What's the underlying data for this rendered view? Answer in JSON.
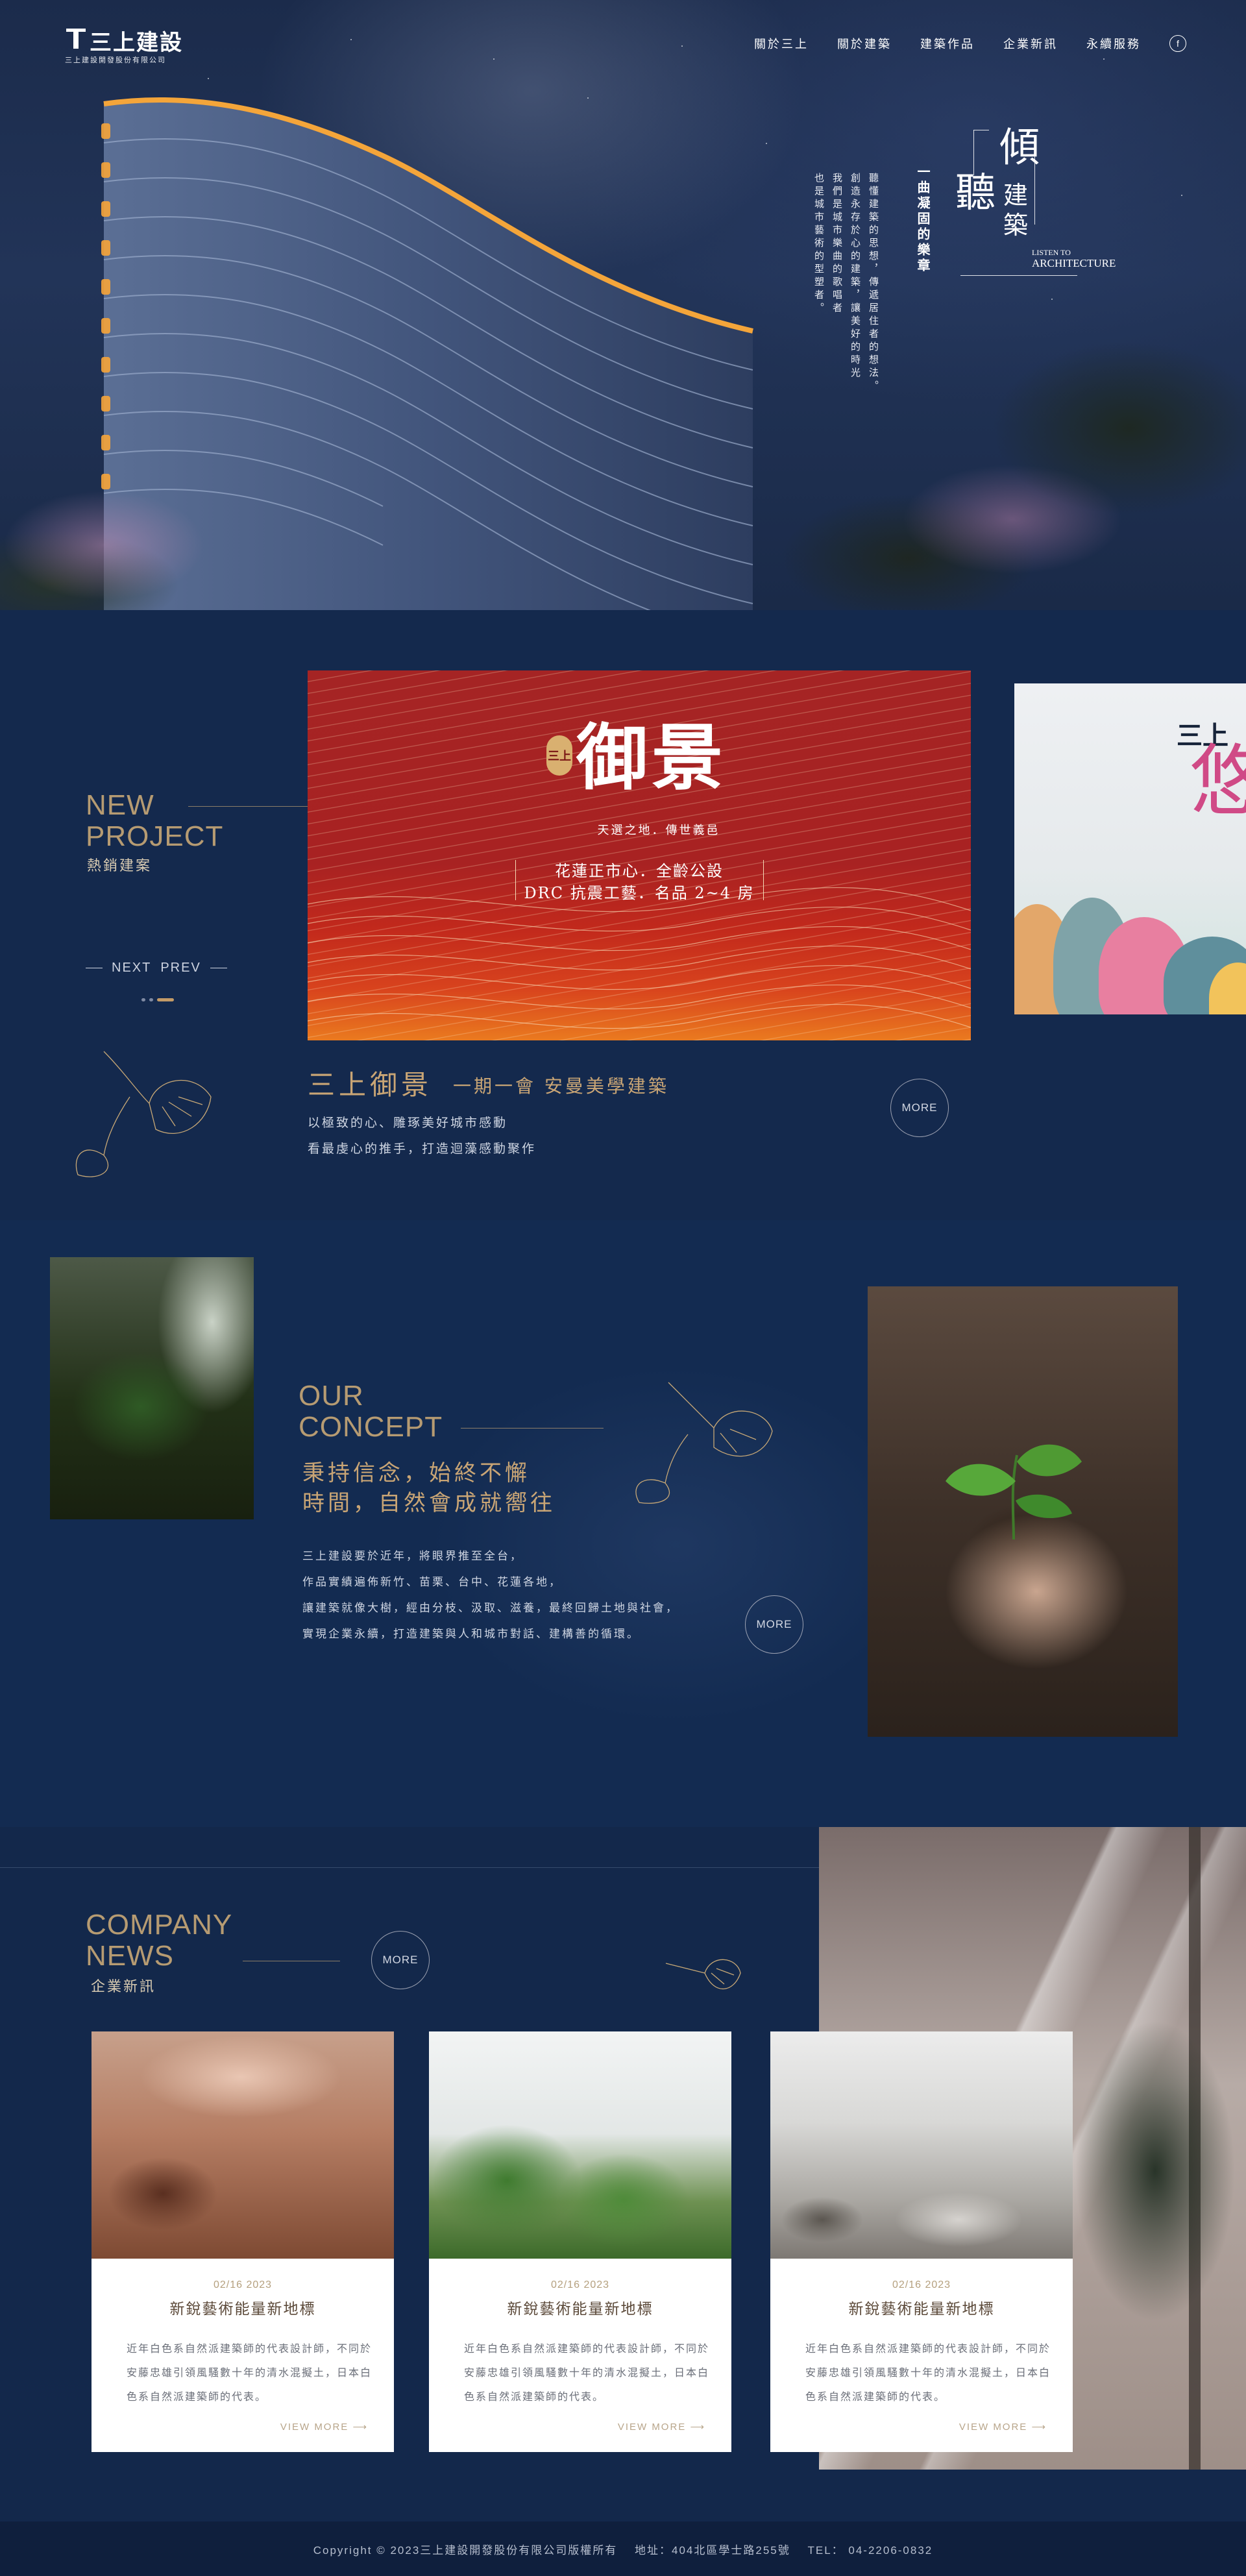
{
  "brand": {
    "name": "三上建設",
    "subtitle": "三上建設開發股份有限公司"
  },
  "nav": {
    "items": [
      "關於三上",
      "關於建築",
      "建築作品",
      "企業新訊",
      "永續服務"
    ],
    "social_icon": "f"
  },
  "hero": {
    "big_1": "傾",
    "big_2": "聽",
    "small_1": "建",
    "small_2": "築",
    "vertical_title": "一曲凝固的樂章",
    "vertical_lines": [
      "聽懂建築的思想，傳遞居住者的想法。",
      "創造永存於心的建築，讓美好的時光",
      "我們是城市樂曲的歌唱者",
      "也是城市藝術的型塑者。"
    ],
    "en_1": "LISTEN TO",
    "en_2": "ARCHITECTURE"
  },
  "project": {
    "en_line1": "NEW",
    "en_line2": "PROJECT",
    "zh": "熱銷建案",
    "nav_next": "NEXT",
    "nav_prev": "PREV",
    "featured": {
      "seal": "三上",
      "brand": "御景",
      "slogan": "天選之地．傳世義邑",
      "tagline_1": "花蓮正市心．全齡公設",
      "tagline_2": "DRC 抗震工藝．名品 2~4 房"
    },
    "next_slide": {
      "mini_brand": "三上",
      "char": "悠"
    },
    "title": "三上御景",
    "title_sub": "一期一會 安曼美學建築",
    "desc_1": "以極致的心、雕琢美好城市感動",
    "desc_2": "看最虔心的推手，打造迴藻感動聚作",
    "more": "MORE"
  },
  "concept": {
    "en_line1": "OUR",
    "en_line2": "CONCEPT",
    "quote_1": "秉持信念，始終不懈",
    "quote_2": "時間，自然會成就嚮往",
    "body": [
      "三上建設要於近年，將眼界推至全台，",
      "作品實績遍佈新竹、苗栗、台中、花蓮各地，",
      "讓建築就像大樹，經由分枝、汲取、滋養，最終回歸土地與社會，",
      "實現企業永續，打造建築與人和城市對話、建構善的循環。"
    ],
    "more": "MORE"
  },
  "news": {
    "en_line1": "COMPANY",
    "en_line2": "NEWS",
    "zh": "企業新訊",
    "more": "MORE",
    "cards": [
      {
        "date": "02/16 2023",
        "title": "新銳藝術能量新地標",
        "excerpt": "近年白色系自然派建築師的代表設計師，不同於安藤忠雄引領風騷數十年的清水混擬土，日本白色系自然派建築師的代表。",
        "view_more": "VIEW MORE ⟶"
      },
      {
        "date": "02/16 2023",
        "title": "新銳藝術能量新地標",
        "excerpt": "近年白色系自然派建築師的代表設計師，不同於安藤忠雄引領風騷數十年的清水混擬土，日本白色系自然派建築師的代表。",
        "view_more": "VIEW MORE ⟶"
      },
      {
        "date": "02/16 2023",
        "title": "新銳藝術能量新地標",
        "excerpt": "近年白色系自然派建築師的代表設計師，不同於安藤忠雄引領風騷數十年的清水混擬土，日本白色系自然派建築師的代表。",
        "view_more": "VIEW MORE ⟶"
      }
    ]
  },
  "footer": {
    "copyright": "Copyright © 2023三上建設開發股份有限公司版權所有",
    "address": "地址：404北區學士路255號",
    "tel": "TEL： 04-2206-0832"
  },
  "colors": {
    "background": "#13284b",
    "gold": "#c9a575",
    "featured_red": "#a82222"
  }
}
